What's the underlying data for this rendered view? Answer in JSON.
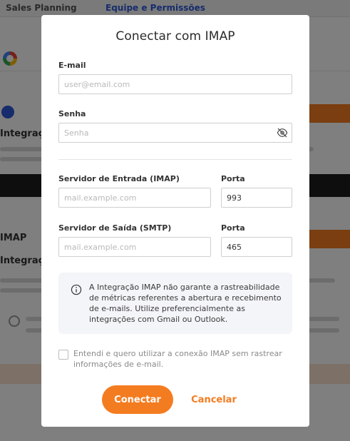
{
  "background": {
    "breadcrumb": "Sales Planning",
    "breadcrumb_link": "Equipe e Permissões",
    "section_a_title": "Integraç",
    "section_b_title": "IMAP",
    "section_c_title": "Integraç"
  },
  "modal": {
    "title": "Conectar com IMAP",
    "email": {
      "label": "E-mail",
      "placeholder": "user@email.com",
      "value": ""
    },
    "password": {
      "label": "Senha",
      "placeholder": "Senha",
      "value": ""
    },
    "incoming": {
      "server_label": "Servidor de Entrada (IMAP)",
      "server_placeholder": "mail.example.com",
      "port_label": "Porta",
      "port_value": "993"
    },
    "outgoing": {
      "server_label": "Servidor de Saída (SMTP)",
      "server_placeholder": "mail.example.com",
      "port_label": "Porta",
      "port_value": "465"
    },
    "info_text": "A Integração IMAP não garante a rastreabilidade de métricas referentes a abertura e recebimento de e-mails. Utilize preferencialmente as integrações com Gmail ou Outlook.",
    "checkbox_label": "Entendi e quero utilizar a conexão IMAP sem rastrear informações de e-mail.",
    "checkbox_checked": false,
    "connect_label": "Conectar",
    "cancel_label": "Cancelar"
  },
  "colors": {
    "accent": "#f47c20",
    "overlay": "rgba(0,0,0,0.5)",
    "info_background": "#f4f5f8"
  },
  "icons": {
    "password_toggle": "eye-off-icon",
    "info": "info-circle-icon"
  }
}
